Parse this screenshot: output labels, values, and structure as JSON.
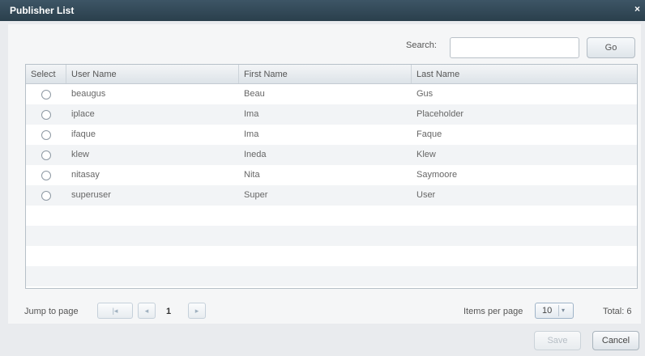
{
  "window": {
    "title": "Publisher List",
    "close_glyph": "×"
  },
  "search": {
    "label": "Search:",
    "value": "",
    "placeholder": "",
    "go_label": "Go"
  },
  "grid": {
    "columns": [
      "Select",
      "User Name",
      "First Name",
      "Last Name"
    ],
    "rows": [
      {
        "user": "beaugus",
        "first": "Beau",
        "last": "Gus"
      },
      {
        "user": "iplace",
        "first": "Ima",
        "last": "Placeholder"
      },
      {
        "user": "ifaque",
        "first": "Ima",
        "last": "Faque"
      },
      {
        "user": "klew",
        "first": "Ineda",
        "last": "Klew"
      },
      {
        "user": "nitasay",
        "first": "Nita",
        "last": "Saymoore"
      },
      {
        "user": "superuser",
        "first": "Super",
        "last": "User"
      }
    ]
  },
  "pager": {
    "jump_label": "Jump to page",
    "first_glyph": "|◂",
    "prev_glyph": "◂",
    "next_glyph": "▸",
    "current_page": "1",
    "items_per_page_label": "Items per page",
    "items_per_page_value": "10",
    "total_text": "Total: 6"
  },
  "actions": {
    "save_label": "Save",
    "cancel_label": "Cancel"
  },
  "icons": {
    "close": "close-icon",
    "radio": "radio-icon",
    "dropdown": "chevron-down-icon"
  }
}
